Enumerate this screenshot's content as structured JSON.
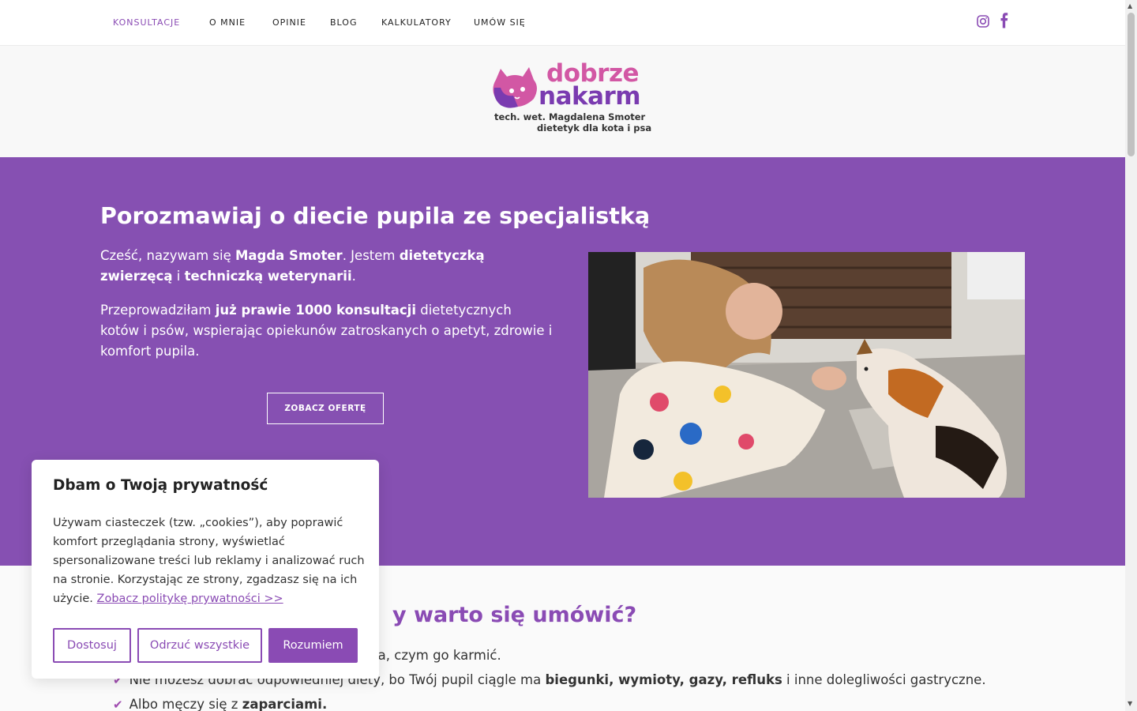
{
  "nav": {
    "items": [
      {
        "label": "KONSULTACJE",
        "active": true
      },
      {
        "label": "O MNIE"
      },
      {
        "label": "OPINIE"
      },
      {
        "label": "BLOG"
      },
      {
        "label": "KALKULATORY"
      },
      {
        "label": "UMÓW SIĘ"
      }
    ],
    "social": [
      "instagram-icon",
      "facebook-icon"
    ]
  },
  "logo": {
    "word1": "dobrze",
    "word2": "nakarm",
    "sub1": "tech. wet. Magdalena Smoter",
    "sub2": "dietetyk dla kota i psa"
  },
  "hero": {
    "title": "Porozmawiaj o diecie pupila ze specjalistką",
    "p1": {
      "t1": "Cześć, nazywam się ",
      "b1": "Magda Smoter",
      "t2": ". Jestem ",
      "b2": "dietetyczką zwierzęcą",
      "t3": " i ",
      "b3": "techniczką weterynarii",
      "t4": "."
    },
    "p2": {
      "t1": "Przeprowadziłam ",
      "b1": "już prawie 1000 konsultacji",
      "t2": " dietetycznych kotów i psów, wspierając opiekunów zatroskanych o apetyt, zdrowie i komfort pupila."
    },
    "cta": "ZOBACZ OFERTĘ"
  },
  "section2": {
    "title": "y warto się umówić?",
    "bullets": [
      {
        "t1": "cia, czym go karmić.",
        "b1": "",
        "t2": ""
      },
      {
        "t1": "Nie możesz dobrać odpowiedniej diety, bo Twój pupil ciągle ma ",
        "b1": "biegunki, wymioty, gazy, refluks",
        "t2": " i inne dolegliwości gastryczne."
      },
      {
        "t1": "Albo męczy się z ",
        "b1": "zaparciami.",
        "t2": ""
      }
    ]
  },
  "cookie": {
    "title": "Dbam o Twoją prywatność",
    "text": "Używam ciasteczek (tzw. „cookies”), aby poprawić komfort przeglądania strony, wyświetlać spersonalizowane treści lub reklamy i analizować ruch na stronie. Korzystając ze strony, zgadzasz się na ich użycie. ",
    "link": "Zobacz politykę prywatności >>",
    "btn_customize": "Dostosuj",
    "btn_reject": "Odrzuć wszystkie",
    "btn_accept": "Rozumiem"
  },
  "colors": {
    "brand_purple": "#8650b2",
    "accent_pink": "#d257a4"
  }
}
